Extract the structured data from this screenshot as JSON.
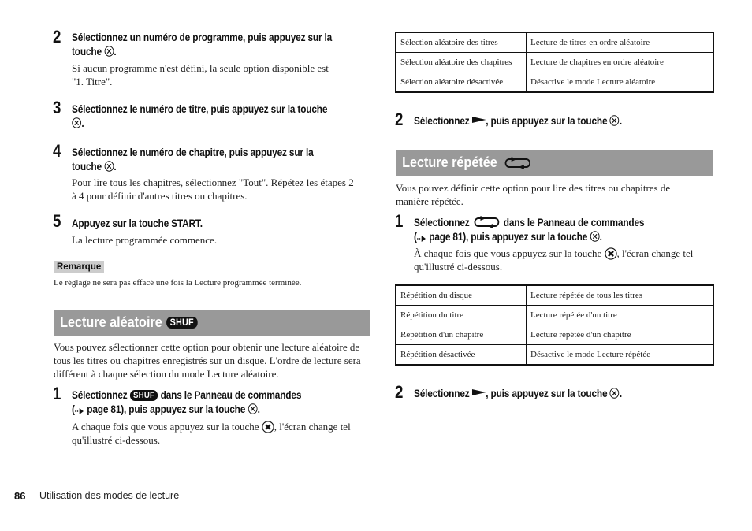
{
  "left_column": {
    "step2": {
      "number": "2",
      "title_line1": "Sélectionnez un numéro de programme, puis appuyez sur la",
      "title_line2_prefix": "touche",
      "title_line2_suffix": ".",
      "body_line1": "Si aucun programme n'est défini, la seule option disponible est",
      "body_line2": "\"1. Titre\"."
    },
    "step3": {
      "number": "3",
      "title_line1": "Sélectionnez le numéro de titre, puis appuyez sur la touche",
      "title_line2_suffix": "."
    },
    "step4": {
      "number": "4",
      "title_line1": "Sélectionnez le numéro de chapitre, puis appuyez sur la",
      "title_line2_prefix": "touche",
      "title_line2_suffix": ".",
      "body_line1": "Pour lire tous les chapitres, sélectionnez \"Tout\". Répétez les étapes 2",
      "body_line2": "à 4 pour définir d'autres titres ou chapitres."
    },
    "step5": {
      "number": "5",
      "title": "Appuyez sur la touche START.",
      "body": "La lecture programmée commence."
    },
    "remark": {
      "label": "Remarque",
      "text": "Le réglage ne sera pas effacé une fois la Lecture programmée terminée."
    },
    "shuffle_section": {
      "title": "Lecture aléatoire",
      "icon_label": "SHUF",
      "intro_line1": "Vous pouvez sélectionner cette option pour obtenir une lecture aléatoire de",
      "intro_line2": "tous les titres ou chapitres enregistrés sur un disque. L'ordre de lecture sera",
      "intro_line3": "différent à chaque sélection du mode Lecture aléatoire.",
      "step1": {
        "number": "1",
        "title_line1_prefix": "Sélectionnez",
        "title_line1_suffix": "dans le Panneau de commandes",
        "title_line2_open": "(",
        "title_line2_ref": "page 81), puis appuyez sur la touche",
        "title_line2_suffix": ".",
        "body_line1_prefix": "A chaque fois que vous appuyez sur la touche",
        "body_line1_suffix": ", l'écran change tel",
        "body_line2": "qu'illustré ci-dessous."
      }
    }
  },
  "right_column": {
    "shuffle_table": {
      "rows": [
        [
          "Sélection aléatoire des titres",
          "Lecture de titres en ordre aléatoire"
        ],
        [
          "Sélection aléatoire des chapitres",
          "Lecture de chapitres en ordre aléatoire"
        ],
        [
          "Sélection aléatoire désactivée",
          "Désactive le mode Lecture aléatoire"
        ]
      ]
    },
    "shuffle_step2": {
      "number": "2",
      "prefix": "Sélectionnez",
      "middle": ", puis appuyez sur la touche",
      "suffix": "."
    },
    "repeat_section": {
      "title": "Lecture répétée",
      "intro_line1": "Vous pouvez définir cette option pour lire des titres ou chapitres de",
      "intro_line2": "manière répétée.",
      "step1": {
        "number": "1",
        "title_line1_prefix": "Sélectionnez",
        "title_line1_suffix": "dans le Panneau de commandes",
        "title_line2_open": "(",
        "title_line2_ref": "page 81), puis appuyez sur la touche",
        "title_line2_suffix": ".",
        "body_line1_prefix": "À chaque fois que vous appuyez sur la touche",
        "body_line1_suffix": ", l'écran change tel",
        "body_line2": "qu'illustré ci-dessous."
      }
    },
    "repeat_table": {
      "rows": [
        [
          "Répétition du disque",
          "Lecture répétée de tous les titres"
        ],
        [
          "Répétition du titre",
          "Lecture répétée d'un titre"
        ],
        [
          "Répétition d'un chapitre",
          "Lecture répétée d'un chapitre"
        ],
        [
          "Répétition désactivée",
          "Désactive le mode Lecture répétée"
        ]
      ]
    },
    "repeat_step2": {
      "number": "2",
      "prefix": "Sélectionnez",
      "middle": ", puis appuyez sur la touche",
      "suffix": "."
    }
  },
  "footer": {
    "page_number": "86",
    "section": "Utilisation des modes de lecture"
  },
  "icons": {
    "cross_button": "cross-button-icon",
    "play": "play-icon",
    "repeat": "repeat-icon",
    "shuffle": "shuffle-icon",
    "page_ref_arrow": "page-reference-arrow-icon"
  },
  "colors": {
    "section_bar": "#999999",
    "remark_bg": "#cccccc",
    "text": "#222222"
  }
}
